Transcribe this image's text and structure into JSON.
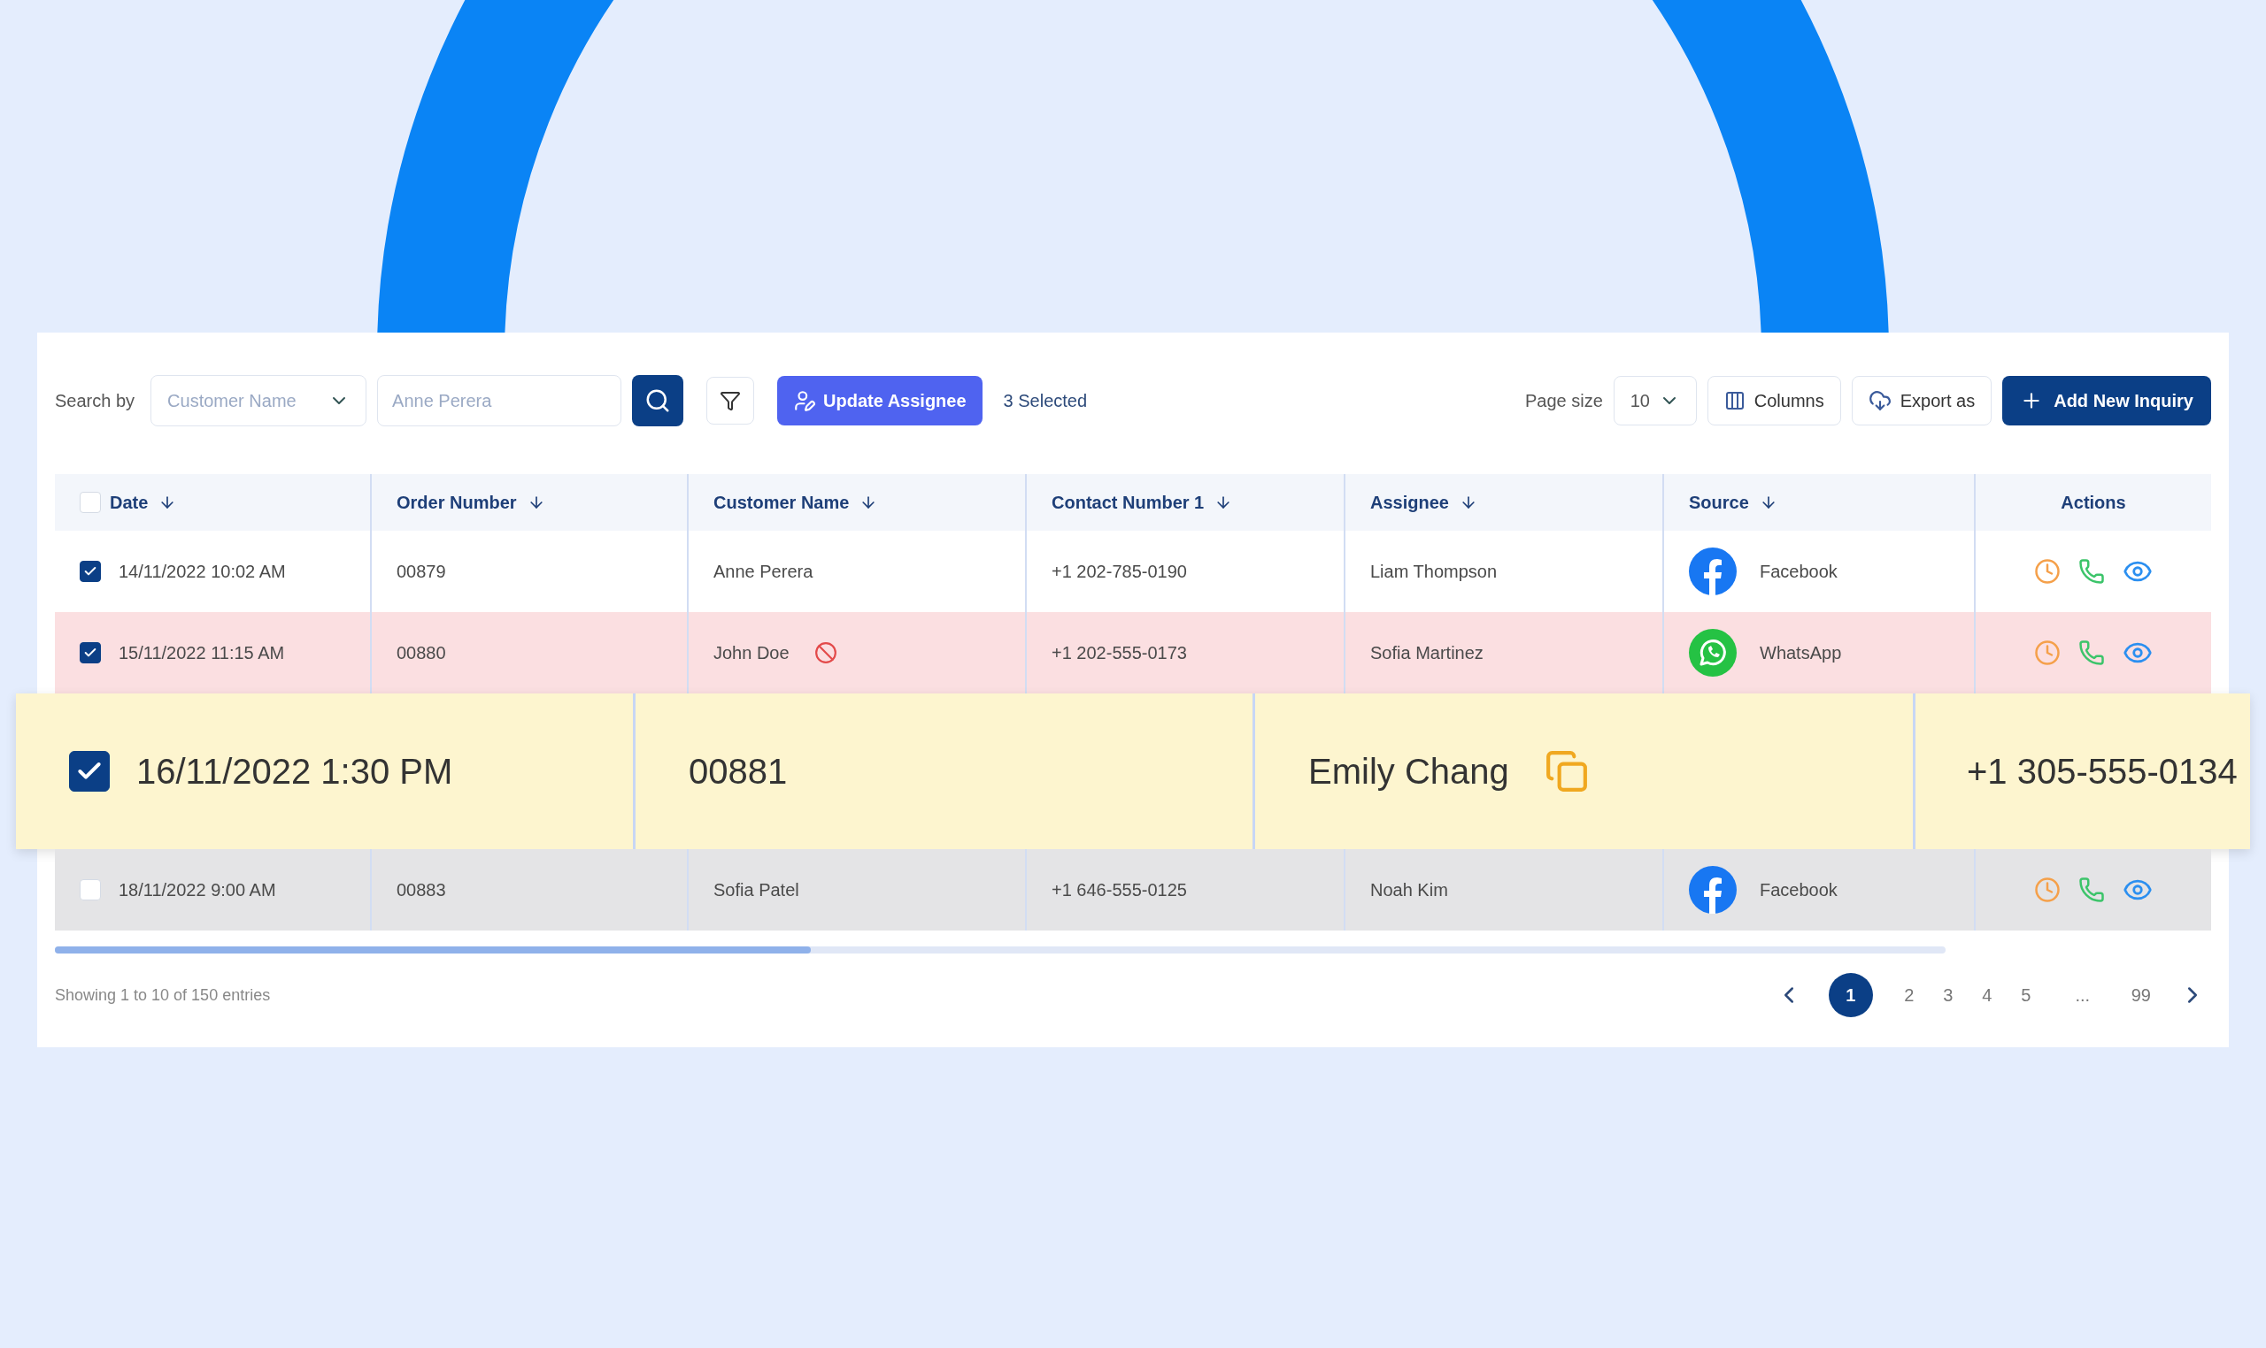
{
  "toolbar": {
    "search_label": "Search by",
    "search_by": {
      "value": "Customer Name"
    },
    "search_field": {
      "placeholder": "Anne Perera"
    },
    "update_button": "Update Assignee",
    "selected_count": "3 Selected",
    "page_size_label": "Page size",
    "page_size": "10",
    "columns_button": "Columns",
    "export_button": "Export as",
    "add_button": "Add New Inquiry"
  },
  "table": {
    "all_checked": false,
    "columns": [
      {
        "label": "Date",
        "sortable": true
      },
      {
        "label": "Order Number",
        "sortable": true
      },
      {
        "label": "Customer Name",
        "sortable": true
      },
      {
        "label": "Contact Number 1",
        "sortable": true
      },
      {
        "label": "Assignee",
        "sortable": true
      },
      {
        "label": "Source",
        "sortable": true
      },
      {
        "label": "Actions",
        "sortable": false
      }
    ],
    "rows": [
      {
        "kind": "normal",
        "checked": true,
        "date": "14/11/2022 10:02 AM",
        "order": "00879",
        "customer": "Anne Perera",
        "blocked": false,
        "contact": "+1 202-785-0190",
        "assignee": "Liam Thompson",
        "source": {
          "kind": "facebook",
          "label": "Facebook"
        }
      },
      {
        "kind": "alert",
        "checked": true,
        "date": "15/11/2022 11:15 AM",
        "order": "00880",
        "customer": "John Doe",
        "blocked": true,
        "contact": "+1 202-555-0173",
        "assignee": "Sofia Martinez",
        "source": {
          "kind": "whatsapp",
          "label": "WhatsApp"
        }
      },
      {
        "kind": "dimmed",
        "checked": false,
        "date": "18/11/2022 9:00 AM",
        "order": "00883",
        "customer": "Sofia Patel",
        "blocked": false,
        "contact": "+1 646-555-0125",
        "assignee": "Noah Kim",
        "source": {
          "kind": "facebook",
          "label": "Facebook"
        }
      }
    ]
  },
  "magnified_row": {
    "checked": true,
    "date": "16/11/2022 1:30 PM",
    "order_number": "00881",
    "customer_name": "Emily Chang",
    "contact_number": "+1 305-555-0134"
  },
  "footer": {
    "entries": "Showing 1 to 10 of 150 entries",
    "pages": [
      {
        "label": "1",
        "selected": true
      },
      {
        "label": "2",
        "selected": false
      },
      {
        "label": "3",
        "selected": false
      },
      {
        "label": "4",
        "selected": false
      },
      {
        "label": "5",
        "selected": false
      },
      {
        "label": "...",
        "selected": false
      },
      {
        "label": "99",
        "selected": false
      }
    ]
  }
}
